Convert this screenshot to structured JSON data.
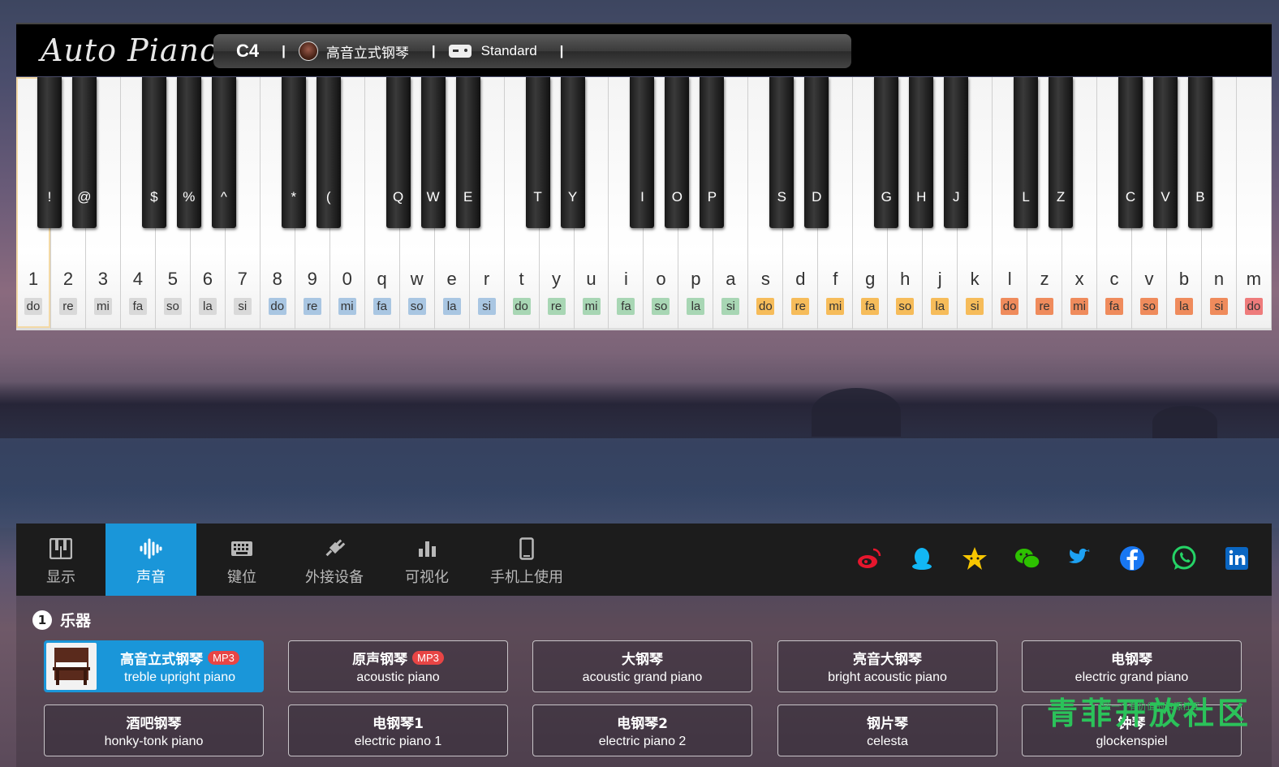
{
  "app": {
    "logo_text": "Auto Piano"
  },
  "status": {
    "note": "C4",
    "separator": "|",
    "instrument": "高音立式钢琴",
    "mode": "Standard"
  },
  "white_keys": [
    {
      "label": "1",
      "solf": "do",
      "color": "#d9d9d9"
    },
    {
      "label": "2",
      "solf": "re",
      "color": "#d9d9d9"
    },
    {
      "label": "3",
      "solf": "mi",
      "color": "#d9d9d9"
    },
    {
      "label": "4",
      "solf": "fa",
      "color": "#d9d9d9"
    },
    {
      "label": "5",
      "solf": "so",
      "color": "#d9d9d9"
    },
    {
      "label": "6",
      "solf": "la",
      "color": "#d9d9d9"
    },
    {
      "label": "7",
      "solf": "si",
      "color": "#d9d9d9"
    },
    {
      "label": "8",
      "solf": "do",
      "color": "#a9c6e2"
    },
    {
      "label": "9",
      "solf": "re",
      "color": "#a9c6e2"
    },
    {
      "label": "0",
      "solf": "mi",
      "color": "#a9c6e2"
    },
    {
      "label": "q",
      "solf": "fa",
      "color": "#a9c6e2"
    },
    {
      "label": "w",
      "solf": "so",
      "color": "#a9c6e2"
    },
    {
      "label": "e",
      "solf": "la",
      "color": "#a9c6e2"
    },
    {
      "label": "r",
      "solf": "si",
      "color": "#a9c6e2"
    },
    {
      "label": "t",
      "solf": "do",
      "color": "#a8d6b4"
    },
    {
      "label": "y",
      "solf": "re",
      "color": "#a8d6b4"
    },
    {
      "label": "u",
      "solf": "mi",
      "color": "#a8d6b4"
    },
    {
      "label": "i",
      "solf": "fa",
      "color": "#a8d6b4"
    },
    {
      "label": "o",
      "solf": "so",
      "color": "#a8d6b4"
    },
    {
      "label": "p",
      "solf": "la",
      "color": "#a8d6b4"
    },
    {
      "label": "a",
      "solf": "si",
      "color": "#a8d6b4"
    },
    {
      "label": "s",
      "solf": "do",
      "color": "#f6bc5a"
    },
    {
      "label": "d",
      "solf": "re",
      "color": "#f6bc5a"
    },
    {
      "label": "f",
      "solf": "mi",
      "color": "#f6bc5a"
    },
    {
      "label": "g",
      "solf": "fa",
      "color": "#f6bc5a"
    },
    {
      "label": "h",
      "solf": "so",
      "color": "#f6bc5a"
    },
    {
      "label": "j",
      "solf": "la",
      "color": "#f6bc5a"
    },
    {
      "label": "k",
      "solf": "si",
      "color": "#f6bc5a"
    },
    {
      "label": "l",
      "solf": "do",
      "color": "#ef8b5c"
    },
    {
      "label": "z",
      "solf": "re",
      "color": "#ef8b5c"
    },
    {
      "label": "x",
      "solf": "mi",
      "color": "#ef8b5c"
    },
    {
      "label": "c",
      "solf": "fa",
      "color": "#ef8b5c"
    },
    {
      "label": "v",
      "solf": "so",
      "color": "#ef8b5c"
    },
    {
      "label": "b",
      "solf": "la",
      "color": "#ef8b5c"
    },
    {
      "label": "n",
      "solf": "si",
      "color": "#ef8b5c"
    },
    {
      "label": "m",
      "solf": "do",
      "color": "#ee7b7b"
    }
  ],
  "black_keys": [
    {
      "label": "!",
      "after": 0
    },
    {
      "label": "@",
      "after": 1
    },
    {
      "label": "$",
      "after": 3
    },
    {
      "label": "%",
      "after": 4
    },
    {
      "label": "^",
      "after": 5
    },
    {
      "label": "*",
      "after": 7
    },
    {
      "label": "(",
      "after": 8
    },
    {
      "label": "Q",
      "after": 10
    },
    {
      "label": "W",
      "after": 11
    },
    {
      "label": "E",
      "after": 12
    },
    {
      "label": "T",
      "after": 14
    },
    {
      "label": "Y",
      "after": 15
    },
    {
      "label": "I",
      "after": 17
    },
    {
      "label": "O",
      "after": 18
    },
    {
      "label": "P",
      "after": 19
    },
    {
      "label": "S",
      "after": 21
    },
    {
      "label": "D",
      "after": 22
    },
    {
      "label": "G",
      "after": 24
    },
    {
      "label": "H",
      "after": 25
    },
    {
      "label": "J",
      "after": 26
    },
    {
      "label": "L",
      "after": 28
    },
    {
      "label": "Z",
      "after": 29
    },
    {
      "label": "C",
      "after": 31
    },
    {
      "label": "V",
      "after": 32
    },
    {
      "label": "B",
      "after": 33
    }
  ],
  "tabs": {
    "display": "显示",
    "sound": "声音",
    "keys": "键位",
    "devices": "外接设备",
    "visualize": "可视化",
    "mobile": "手机上使用"
  },
  "social_colors": {
    "weibo": "#e6162d",
    "qq": "#12b7f5",
    "star": "#f7c600",
    "wechat": "#2dc100",
    "twitter": "#1da1f2",
    "facebook": "#1877f2",
    "whatsapp": "#25d366",
    "linkedin": "#0a66c2"
  },
  "section": {
    "number": "1",
    "title": "乐器"
  },
  "instruments": [
    {
      "cn": "高音立式钢琴",
      "en": "treble upright piano",
      "badge": "MP3"
    },
    {
      "cn": "原声钢琴",
      "en": "acoustic piano",
      "badge": "MP3"
    },
    {
      "cn": "大钢琴",
      "en": "acoustic grand piano",
      "badge": ""
    },
    {
      "cn": "亮音大钢琴",
      "en": "bright acoustic piano",
      "badge": ""
    },
    {
      "cn": "电钢琴",
      "en": "electric grand piano",
      "badge": ""
    },
    {
      "cn": "酒吧钢琴",
      "en": "honky-tonk piano",
      "badge": ""
    },
    {
      "cn": "电钢琴1",
      "en": "electric piano 1",
      "badge": ""
    },
    {
      "cn": "电钢琴2",
      "en": "electric piano 2",
      "badge": ""
    },
    {
      "cn": "钢片琴",
      "en": "celesta",
      "badge": ""
    },
    {
      "cn": "钟琴",
      "en": "glockenspiel",
      "badge": ""
    }
  ],
  "watermark": {
    "text": "青菲开放社区",
    "tagline": "做一个有价值的资源社区"
  }
}
